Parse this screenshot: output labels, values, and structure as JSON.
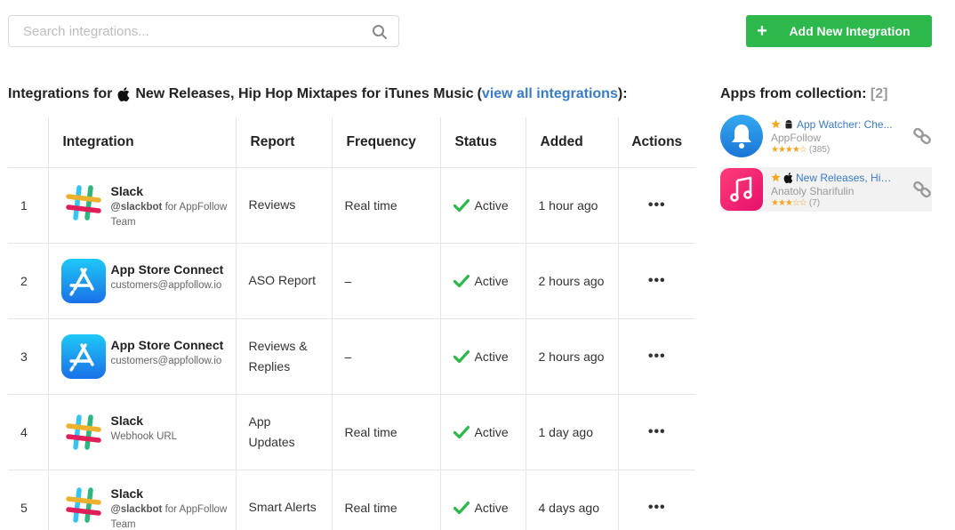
{
  "search": {
    "placeholder": "Search integrations..."
  },
  "add_button": {
    "plus": "+",
    "label": "Add New Integration"
  },
  "section": {
    "prefix": "Integrations for",
    "app_name": "New Releases, Hip Hop Mixtapes for iTunes Music",
    "open_paren": "(",
    "link": "view all integrations",
    "close": "):"
  },
  "table": {
    "headers": {
      "num": "",
      "integration": "Integration",
      "report": "Report",
      "frequency": "Frequency",
      "status": "Status",
      "added": "Added",
      "actions": "Actions"
    },
    "rows": [
      {
        "num": "1",
        "logo": "slack-logo",
        "name": "Slack",
        "sub_bold": "@slackbot",
        "sub_rest": " for AppFollow Team",
        "report": "Reviews",
        "frequency": "Real time",
        "status": "Active",
        "added": "1 hour ago",
        "actions": "•••"
      },
      {
        "num": "2",
        "logo": "app-store-logo",
        "name": "App Store Connect",
        "sub_bold": "",
        "sub_rest": "customers@appfollow.io",
        "report": "ASO Report",
        "frequency": "–",
        "status": "Active",
        "added": "2 hours ago",
        "actions": "•••"
      },
      {
        "num": "3",
        "logo": "app-store-logo",
        "name": "App Store Connect",
        "sub_bold": "",
        "sub_rest": "customers@appfollow.io",
        "report": "Reviews & Replies",
        "frequency": "–",
        "status": "Active",
        "added": "2 hours ago",
        "actions": "•••"
      },
      {
        "num": "4",
        "logo": "slack-logo",
        "name": "Slack",
        "sub_bold": "",
        "sub_rest": "Webhook URL",
        "report": "App Updates",
        "frequency": "Real time",
        "status": "Active",
        "added": "1 day ago",
        "actions": "•••"
      },
      {
        "num": "5",
        "logo": "slack-logo",
        "name": "Slack",
        "sub_bold": "@slackbot",
        "sub_rest": " for AppFollow Team",
        "report": "Smart Alerts",
        "frequency": "Real time",
        "status": "Active",
        "added": "4 days ago",
        "actions": "•••"
      }
    ]
  },
  "collection": {
    "title": "Apps from collection:",
    "count": "[2]",
    "apps": [
      {
        "name": "App Watcher: Che...",
        "developer": "AppFollow",
        "stars": "★★★★☆",
        "rating_count": "(385)",
        "platform": "android-icon",
        "icon": "bell-app-icon"
      },
      {
        "name": "New Releases, Hip ...",
        "developer": "Anatoly Sharifulin",
        "stars": "★★★☆☆",
        "rating_count": "(7)",
        "platform": "apple-icon",
        "icon": "music-app-icon"
      }
    ]
  },
  "colors": {
    "accent_green": "#2db84c",
    "link_blue": "#3a7bc8",
    "star": "#f5a623"
  }
}
